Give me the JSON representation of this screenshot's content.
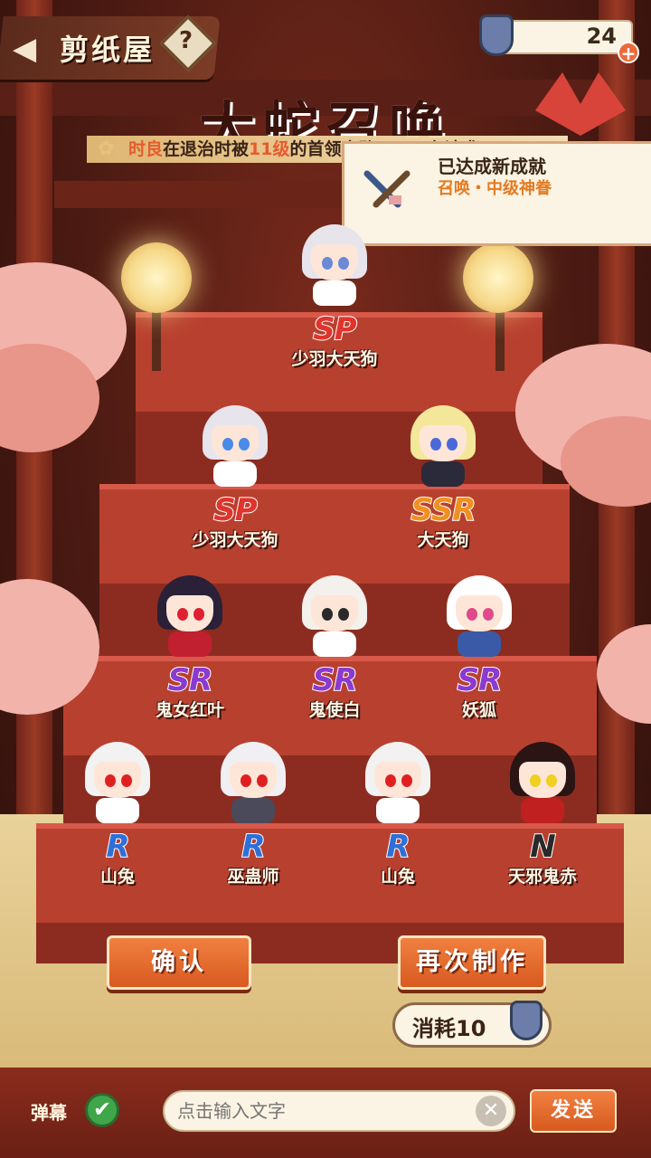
{
  "header": {
    "title": "剪纸屋",
    "back_icon": "chevron-left-icon",
    "help_icon": "question-icon",
    "help_glyph": "?",
    "currency_value": "24",
    "currency_icon": "paper-doll-ticket-icon",
    "currency_plus": "+"
  },
  "banner": {
    "title": "大蛇召唤"
  },
  "notice": {
    "part1": "时良",
    "part2": "在退治时被",
    "part3": "11级",
    "part4": "的首领击败了，正在请求"
  },
  "achievement": {
    "title": "已达成新成就",
    "subtitle": "召唤・中级神眷"
  },
  "cards": [
    {
      "rarity": "SP",
      "name": "少羽大天狗",
      "hair": "#e8e4ec",
      "eye": "#6a8ad8",
      "body": "#ffffff"
    },
    {
      "rarity": "SP",
      "name": "少羽大天狗",
      "hair": "#e8e4ec",
      "eye": "#4a8ae8",
      "body": "#ffffff"
    },
    {
      "rarity": "SSR",
      "name": "大天狗",
      "hair": "#f4e79a",
      "eye": "#4a6ad8",
      "body": "#2a2a3a"
    },
    {
      "rarity": "SR",
      "name": "鬼女红叶",
      "hair": "#2a2038",
      "eye": "#e02030",
      "body": "#c02030"
    },
    {
      "rarity": "SR",
      "name": "鬼使白",
      "hair": "#f4f0ec",
      "eye": "#2a2a2a",
      "body": "#ffffff"
    },
    {
      "rarity": "SR",
      "name": "妖狐",
      "hair": "#ffffff",
      "eye": "#e04a8a",
      "body": "#3a5aa8"
    },
    {
      "rarity": "R",
      "name": "山兔",
      "hair": "#f2f2f2",
      "eye": "#e02020",
      "body": "#ffffff"
    },
    {
      "rarity": "R",
      "name": "巫蛊师",
      "hair": "#f0f0f4",
      "eye": "#e02020",
      "body": "#4a4a5a"
    },
    {
      "rarity": "R",
      "name": "山兔",
      "hair": "#f2f2f2",
      "eye": "#e02020",
      "body": "#ffffff"
    },
    {
      "rarity": "N",
      "name": "天邪鬼赤",
      "hair": "#2a1414",
      "eye": "#f0d020",
      "body": "#c02020"
    }
  ],
  "actions": {
    "confirm": "确认",
    "again": "再次制作",
    "cost": "消耗10",
    "cost_icon": "paper-doll-ticket-icon"
  },
  "chat": {
    "danmaku_label": "弹幕",
    "danmaku_enabled": true,
    "check_glyph": "✔",
    "input_placeholder": "点击输入文字",
    "clear_glyph": "✕",
    "send": "发送"
  },
  "colors": {
    "accent": "#e65b2d",
    "rarity_SP": "#e0342c",
    "rarity_SSR": "#f09020",
    "rarity_SR": "#8a3ad0",
    "rarity_R": "#2e6fd8",
    "rarity_N": "#2a2a2a"
  }
}
